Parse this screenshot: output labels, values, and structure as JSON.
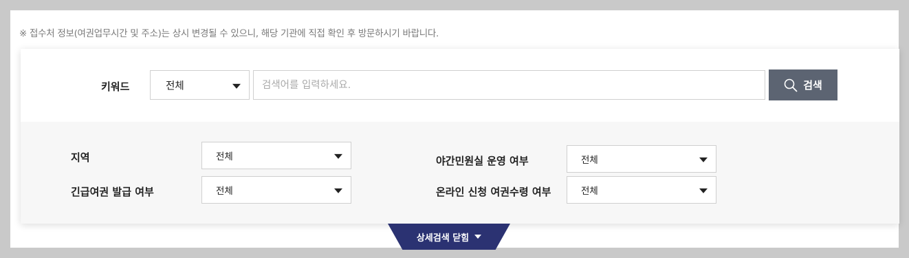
{
  "notice": "※ 접수처 정보(여권업무시간 및 주소)는 상시 변경될 수 있으니, 해당 기관에 직접 확인 후 방문하시기 바랍니다.",
  "search": {
    "keyword_label": "키워드",
    "scope_value": "전체",
    "placeholder": "검색어를 입력하세요.",
    "button_label": "검색"
  },
  "filters": {
    "region": {
      "label": "지역",
      "value": "전체"
    },
    "emergency_passport": {
      "label": "긴급여권 발급 여부",
      "value": "전체"
    },
    "night_office": {
      "label": "야간민원실 운영 여부",
      "value": "전체"
    },
    "online_application": {
      "label": "온라인 신청 여권수령 여부",
      "value": "전체"
    }
  },
  "toggle": {
    "label": "상세검색 닫힘"
  },
  "colors": {
    "search_button": "#5c6472",
    "toggle_tab": "#2b3272"
  }
}
